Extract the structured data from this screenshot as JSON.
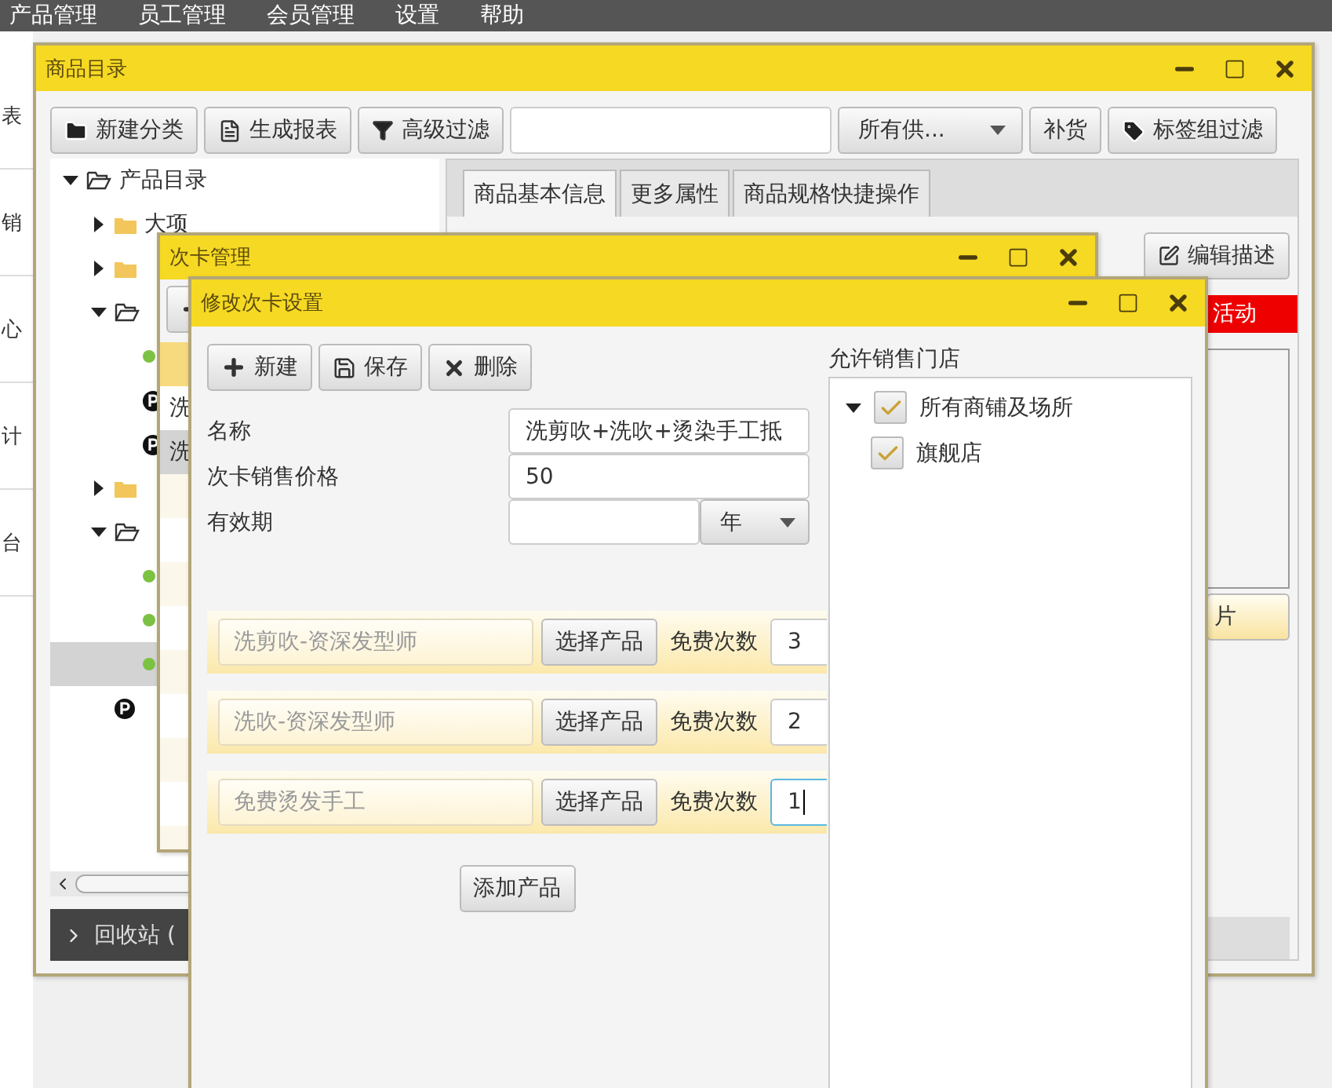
{
  "menu": [
    "产品管理",
    "员工管理",
    "会员管理",
    "设置",
    "帮助"
  ],
  "side_nav": [
    "表",
    "销",
    "心",
    "计",
    "台"
  ],
  "catalog_window": {
    "title": "商品目录",
    "toolbar": [
      {
        "label": "新建分类",
        "kind": "folder-plus"
      },
      {
        "label": "生成报表",
        "kind": "report"
      },
      {
        "label": "高级过滤",
        "kind": "filter"
      }
    ],
    "supplier_select": "所有供...",
    "restock_button": "补货",
    "tag_filter_button": "标签组过滤",
    "tree": [
      {
        "label": "产品目录",
        "kind": "folder",
        "expanded": true,
        "selected": false,
        "children": [
          {
            "label": "大项",
            "kind": "folder",
            "expanded": false,
            "selected": false
          },
          {
            "kind": "folder",
            "expanded": false,
            "selected": false
          },
          {
            "kind": "folder",
            "expanded": true,
            "selected": false,
            "children": [
              {
                "kind": "dot",
                "selected": false
              },
              {
                "kind": "product",
                "selected": false
              },
              {
                "kind": "product",
                "selected": false
              }
            ]
          },
          {
            "kind": "folder",
            "expanded": false,
            "selected": false
          },
          {
            "kind": "folder",
            "expanded": true,
            "selected": false,
            "children": [
              {
                "kind": "dot",
                "selected": false
              },
              {
                "kind": "dot",
                "selected": false
              },
              {
                "kind": "dot",
                "selected": true
              }
            ]
          },
          {
            "kind": "product",
            "selected": false
          }
        ]
      }
    ],
    "recycle_bin": "回收站 (",
    "tabs": [
      {
        "label": "商品基本信息",
        "selected": true
      },
      {
        "label": "更多属性",
        "selected": false
      },
      {
        "label": "商品规格快捷操作",
        "selected": false
      }
    ],
    "edit_description_button": "编辑描述",
    "promo_banner": "活动",
    "image_button": "片"
  },
  "card_window": {
    "title": "次卡管理",
    "rows": [
      {
        "text": "洗",
        "selected": false
      },
      {
        "text": "洗",
        "selected": true
      }
    ]
  },
  "edit_window": {
    "title": "修改次卡设置",
    "toolbar": [
      {
        "label": "新建",
        "kind": "plus"
      },
      {
        "label": "保存",
        "kind": "save"
      },
      {
        "label": "删除",
        "kind": "x"
      }
    ],
    "fields": [
      {
        "label": "名称",
        "value": "洗剪吹+洗吹+烫染手工抵"
      },
      {
        "label": "次卡销售价格",
        "value": "50"
      },
      {
        "label": "有效期",
        "unit": "年"
      }
    ],
    "products": [
      {
        "name": "洗剪吹-资深发型师",
        "button": "选择产品",
        "count_label": "免费次数",
        "count": "3",
        "focused": false
      },
      {
        "name": "洗吹-资深发型师",
        "button": "选择产品",
        "count_label": "免费次数",
        "count": "2",
        "focused": false
      },
      {
        "name": "免费烫发手工",
        "button": "选择产品",
        "count_label": "免费次数",
        "count": "1",
        "focused": true
      }
    ],
    "add_button": "添加产品",
    "stores_label": "允许销售门店",
    "stores": [
      {
        "label": "所有商铺及场所",
        "checked": true,
        "expanded": true,
        "children": [
          {
            "label": "旗舰店",
            "checked": true
          }
        ]
      }
    ]
  }
}
